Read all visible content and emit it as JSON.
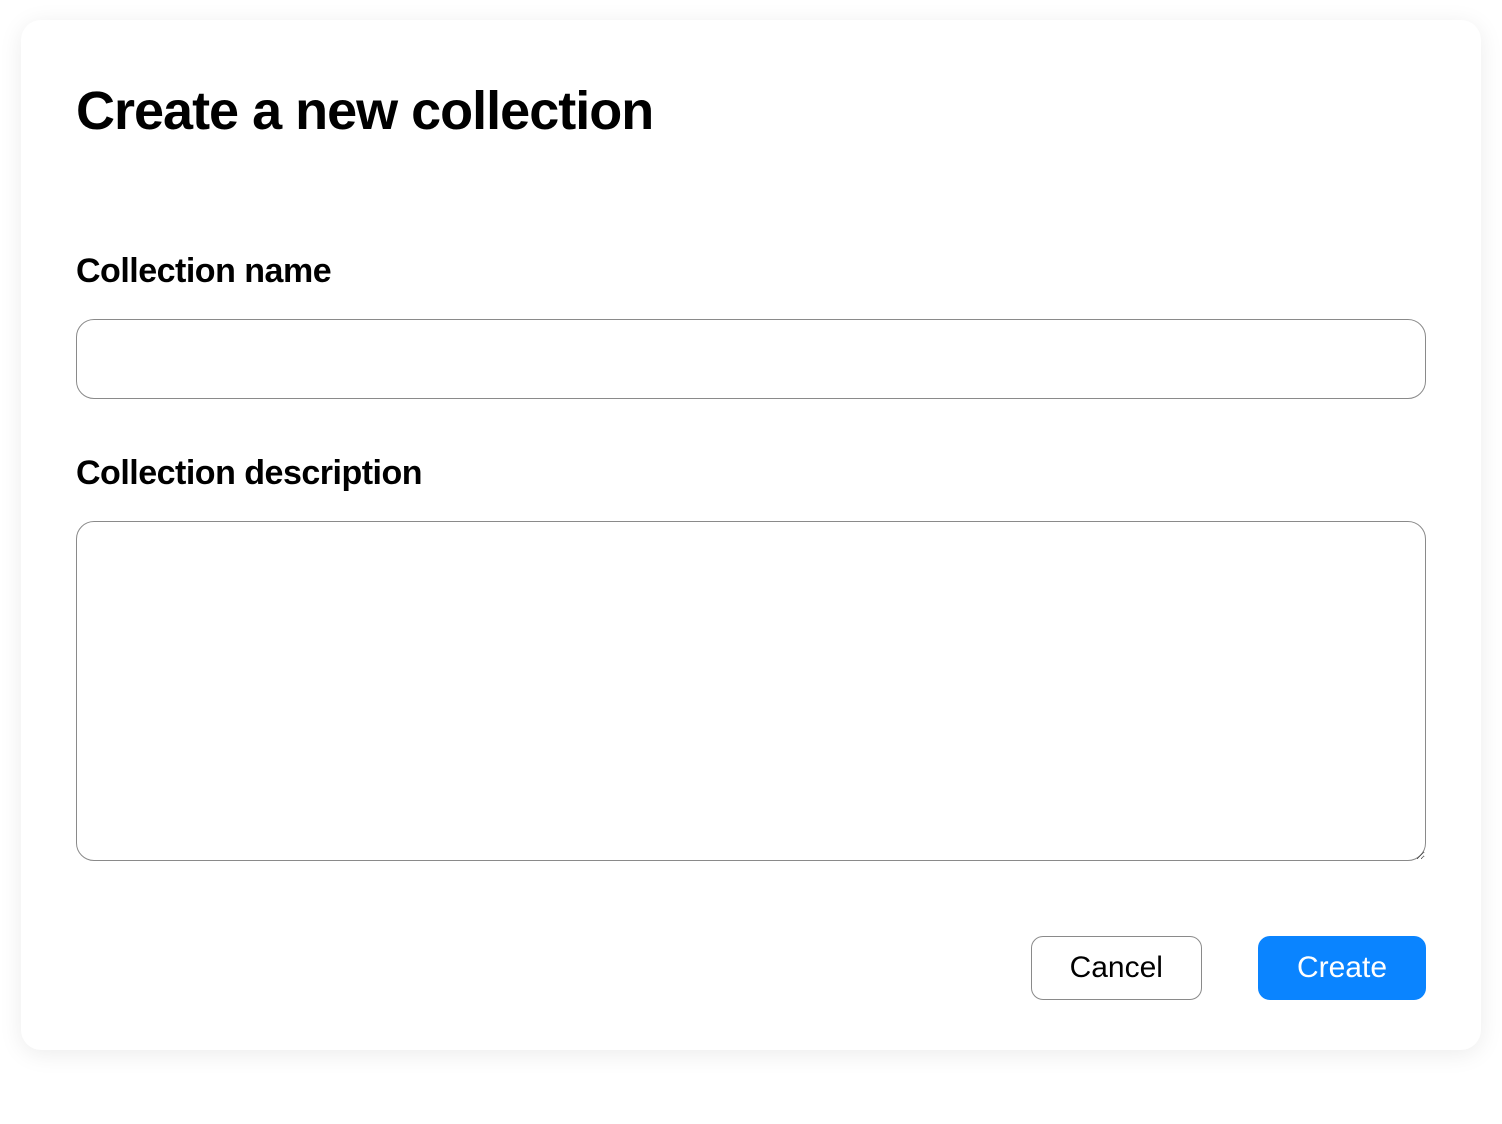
{
  "modal": {
    "title": "Create a new collection",
    "fields": {
      "name": {
        "label": "Collection name",
        "value": "",
        "placeholder": ""
      },
      "description": {
        "label": "Collection description",
        "value": "",
        "placeholder": ""
      }
    },
    "buttons": {
      "cancel": "Cancel",
      "create": "Create"
    }
  }
}
